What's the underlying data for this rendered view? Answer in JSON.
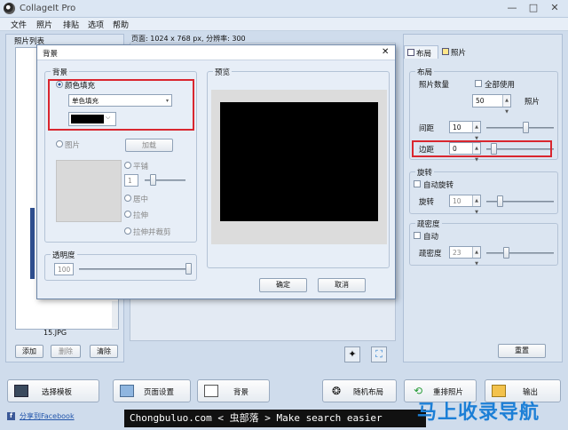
{
  "app": {
    "title": "CollageIt Pro"
  },
  "window_controls": {
    "minimize": "—",
    "maximize": "□",
    "close": "✕"
  },
  "menu": [
    "文件",
    "照片",
    "排贴",
    "选项",
    "帮助"
  ],
  "photo_list": {
    "title": "照片列表",
    "filename": "15.JPG",
    "add": "添加",
    "delete": "删除",
    "clear": "清除"
  },
  "page_info": "页面: 1024 x 768 px, 分辨率: 300",
  "right_panel": {
    "tabs": [
      "布局",
      "照片"
    ],
    "layout_group": "布局",
    "photo_count_label": "照片数量",
    "use_all": "全部使用",
    "photo_count": "50",
    "photo_unit": "照片",
    "spacing_label": "间距",
    "spacing_value": "10",
    "margin_label": "边距",
    "margin_value": "0",
    "rotation_group": "旋转",
    "auto_rotate": "自动旋转",
    "rotate_label": "旋转",
    "rotate_value": "10",
    "density_group": "疏密度",
    "auto_density": "自动",
    "density_label": "疏密度",
    "density_value": "23",
    "reset": "重置"
  },
  "dialog": {
    "title": "背景",
    "close": "✕",
    "bg_group": "背景",
    "color_fill": "颜色填充",
    "fill_type": "单色填充",
    "fill_color": "#000000",
    "picture": "图片",
    "load": "加载",
    "tile": "平铺",
    "tile_value": "1",
    "center": "居中",
    "stretch": "拉伸",
    "stretch_crop": "拉伸并裁剪",
    "opacity_group": "透明度",
    "opacity_value": "100",
    "preview_group": "预览",
    "ok": "确定",
    "cancel": "取消"
  },
  "bottom_buttons": {
    "choose_template": "选择模板",
    "page_setup": "页面设置",
    "background": "背景",
    "random_layout": "随机布局",
    "rearrange": "重排照片",
    "export": "输出"
  },
  "share": "分享到Facebook",
  "watermark": "Chongbuluo.com < 虫部落 > Make search easier",
  "watermark_logo": "马上收录导航",
  "colors": {
    "accent": "#d9262f",
    "preview_bg": "#000000"
  }
}
